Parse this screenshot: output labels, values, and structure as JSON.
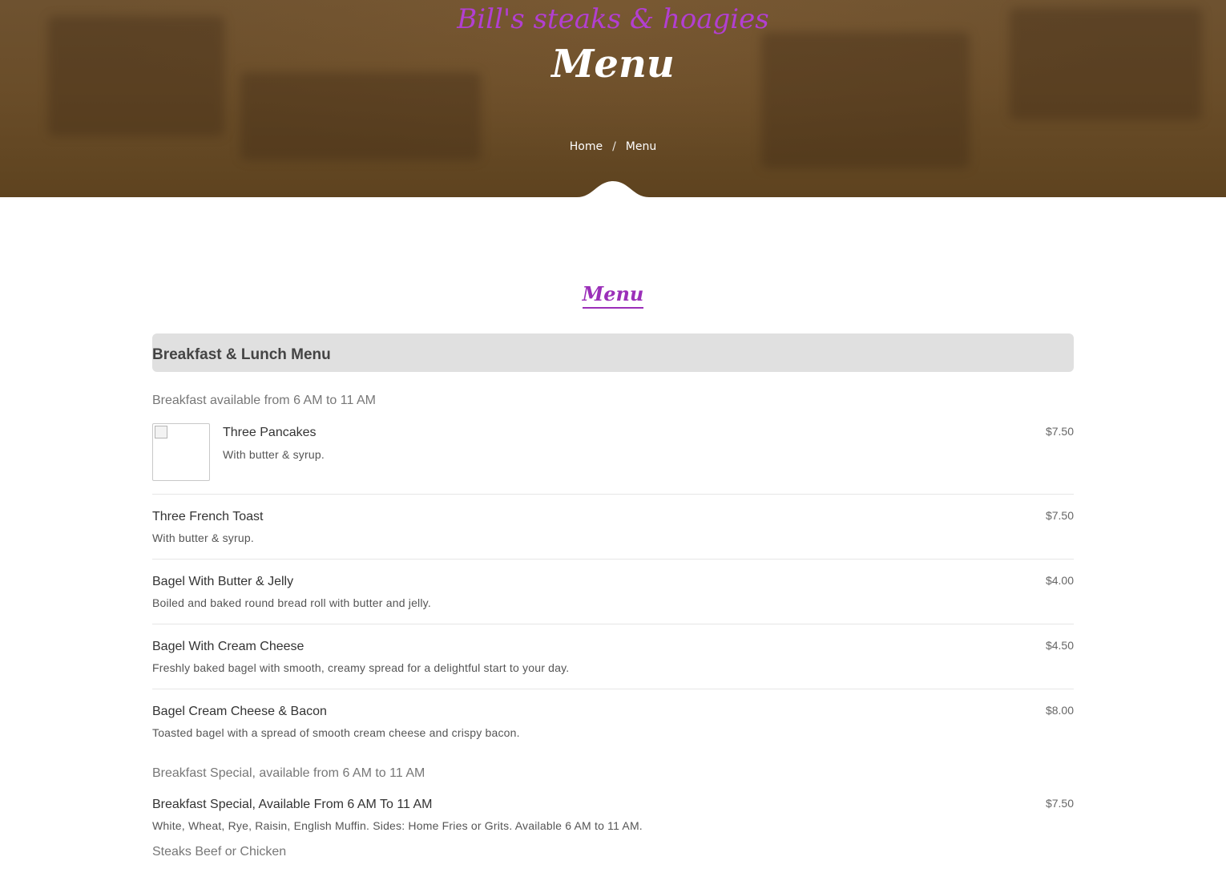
{
  "header": {
    "brand": "Bill's steaks & hoagies",
    "title": "Menu",
    "breadcrumb": {
      "home": "Home",
      "separator": "/",
      "current": "Menu"
    }
  },
  "section": {
    "heading": "Menu"
  },
  "menu": {
    "category": "Breakfast & Lunch Menu",
    "groups": [
      {
        "subtitle": "Breakfast available from 6 AM to 11 AM",
        "items": [
          {
            "name": "Three Pancakes",
            "description": "With butter & syrup.",
            "price": "$7.50"
          },
          {
            "name": "Three French Toast",
            "description": "With butter & syrup.",
            "price": "$7.50"
          },
          {
            "name": "Bagel With Butter & Jelly",
            "description": "Boiled and baked round bread roll with butter and jelly.",
            "price": "$4.00"
          },
          {
            "name": "Bagel With Cream Cheese",
            "description": "Freshly baked bagel with smooth, creamy spread for a delightful start to your day.",
            "price": "$4.50"
          },
          {
            "name": "Bagel Cream Cheese & Bacon",
            "description": "Toasted bagel with a spread of smooth cream cheese and crispy bacon.",
            "price": "$8.00"
          }
        ]
      },
      {
        "subtitle": "Breakfast Special, available from 6 AM to 11 AM",
        "items": [
          {
            "name": "Breakfast Special, Available From 6 AM To 11 AM",
            "description": "White, Wheat, Rye, Raisin, English Muffin. Sides: Home Fries or Grits. Available 6 AM to 11 AM.",
            "price": "$7.50"
          }
        ]
      },
      {
        "subtitle": "Steaks Beef or Chicken",
        "items": []
      }
    ]
  },
  "colors": {
    "accent": "#9b2fb9",
    "hero": "#6a4d29",
    "category_bar": "#e0e0e0"
  }
}
